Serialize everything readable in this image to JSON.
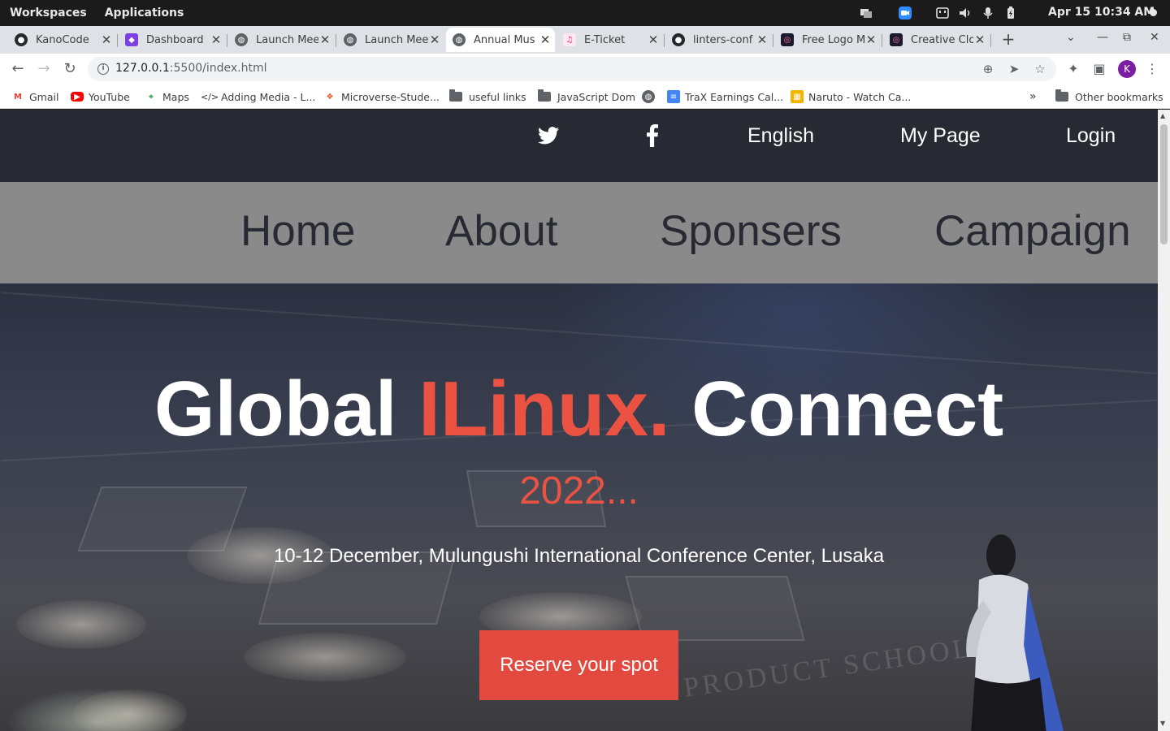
{
  "os": {
    "workspaces": "Workspaces",
    "applications": "Applications",
    "clock": "Apr 15  10:34 AM"
  },
  "tabs": [
    {
      "title": "KanoCode",
      "icon": "github-icon"
    },
    {
      "title": "Dashboard",
      "icon": "dashboard-app-icon"
    },
    {
      "title": "Launch Mee",
      "icon": "globe-icon"
    },
    {
      "title": "Launch Mee",
      "icon": "globe-icon"
    },
    {
      "title": "Annual Mus",
      "icon": "globe-icon",
      "active": true
    },
    {
      "title": "E-Ticket",
      "icon": "music-note-icon"
    },
    {
      "title": "linters-conf",
      "icon": "github-icon"
    },
    {
      "title": "Free Logo M",
      "icon": "logo-maker-icon"
    },
    {
      "title": "Creative Clo",
      "icon": "logo-maker-icon"
    }
  ],
  "address": {
    "host": "127.0.0.1",
    "path": ":5500/index.html"
  },
  "bookmarks": [
    {
      "label": "Gmail",
      "icon": "gmail-icon"
    },
    {
      "label": "YouTube",
      "icon": "youtube-icon"
    },
    {
      "label": "Maps",
      "icon": "maps-icon"
    },
    {
      "label": "Adding Media - L...",
      "icon": "code-icon"
    },
    {
      "label": "Microverse-Stude...",
      "icon": "figma-icon"
    },
    {
      "label": "useful links",
      "icon": "folder-icon"
    },
    {
      "label": "JavaScript Dom",
      "icon": "folder-icon"
    },
    {
      "label": "",
      "icon": "globe-icon"
    },
    {
      "label": "TraX Earnings Cal...",
      "icon": "docs-icon"
    },
    {
      "label": "Naruto - Watch Ca...",
      "icon": "site-icon"
    }
  ],
  "other_bookmarks": "Other bookmarks",
  "overflow_chevron": "»",
  "site": {
    "top_links": {
      "language": "English",
      "my_page": "My Page",
      "login": "Login"
    },
    "nav": [
      "Home",
      "About",
      "Sponsers",
      "Campaign"
    ],
    "hero": {
      "title_pre": "Global ",
      "title_accent": "ILinux.",
      "title_post": " Connect",
      "year": "2022...",
      "subtitle": "10-12 December, Mulungushi International Conference Center, Lusaka",
      "cta": "Reserve your spot",
      "watermark": "PRODUCT SCHOOL"
    }
  },
  "colors": {
    "accent": "#ec5242",
    "topbar": "#272a33",
    "nav_bg": "#8a8a8a",
    "cta_bg": "#e24a3f"
  }
}
